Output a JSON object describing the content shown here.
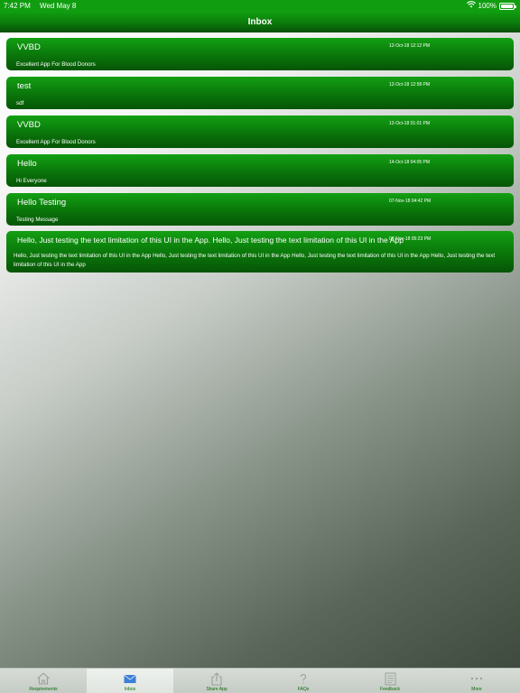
{
  "status_bar": {
    "time": "7:42 PM",
    "date": "Wed May 8",
    "battery": "100%"
  },
  "nav": {
    "title": "Inbox"
  },
  "messages": [
    {
      "title": "VVBD",
      "date": "12-Oct-18 12:12 PM",
      "body": "Excellent App For Blood Donors"
    },
    {
      "title": "test",
      "date": "12-Oct-18 12:58 PM",
      "body": "sdf"
    },
    {
      "title": "VVBD",
      "date": "12-Oct-18 01:01 PM",
      "body": "Excellent App For Blood Donors"
    },
    {
      "title": "Hello",
      "date": "14-Oct-18 04:05 PM",
      "body": "Hi Everyone"
    },
    {
      "title": "Hello Testing",
      "date": "07-Nov-18 04:42 PM",
      "body": "Testing Message"
    },
    {
      "title": "Hello, Just testing the text limitation of this UI in the App. Hello, Just testing the text limitation of this UI in the App",
      "date": "07-Nov-18 05:23 PM",
      "body": "Hello, Just testing the text limitation of this UI in the App Hello, Just testing the text limitation of this UI in the App Hello, Just testing the text limitation of this UI in the App Hello, Just testing the text limitation of this UI in the App"
    }
  ],
  "tabs": [
    {
      "label": "Requirements",
      "icon": "home-icon"
    },
    {
      "label": "Inbox",
      "icon": "mail-icon",
      "active": true
    },
    {
      "label": "Share App",
      "icon": "share-icon"
    },
    {
      "label": "FAQs",
      "icon": "question-icon"
    },
    {
      "label": "Feedback",
      "icon": "document-icon"
    },
    {
      "label": "More",
      "icon": "more-icon"
    }
  ],
  "colors": {
    "accent": "#0b7d0b",
    "active_icon": "#3b7fd6",
    "inactive_icon": "#9aa09a"
  }
}
